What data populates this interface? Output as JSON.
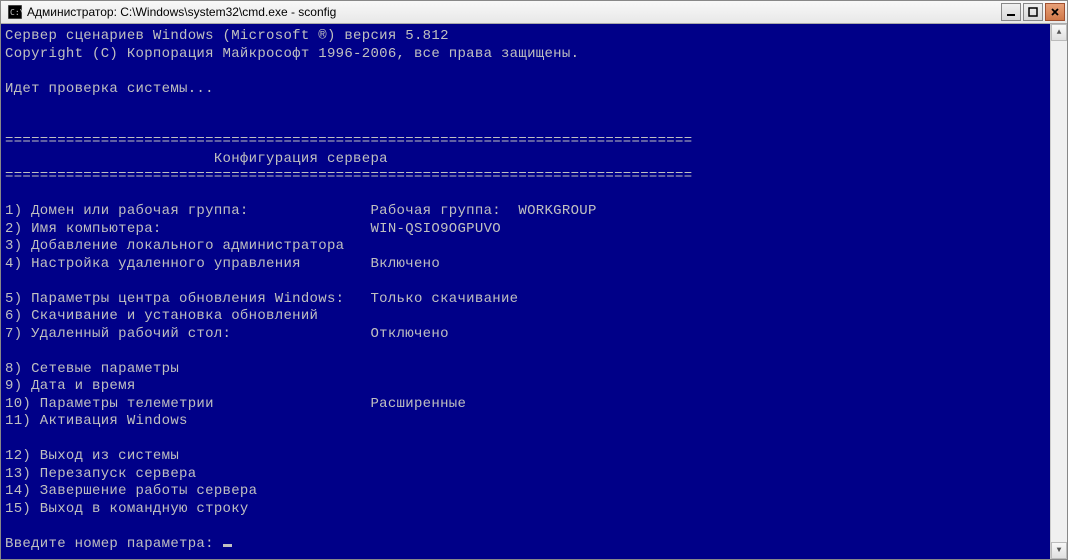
{
  "window": {
    "title": "Администратор: C:\\Windows\\system32\\cmd.exe - sconfig"
  },
  "console": {
    "header1": "Сервер сценариев Windows (Microsoft ®) версия 5.812",
    "header2": "Copyright (C) Корпорация Майкрософт 1996-2006, все права защищены.",
    "checking": "Идет проверка системы...",
    "divider": "===============================================================================",
    "section_title": "                        Конфигурация сервера",
    "options": [
      {
        "num": "1",
        "label": "Домен или рабочая группа:",
        "value": "Рабочая группа:  WORKGROUP"
      },
      {
        "num": "2",
        "label": "Имя компьютера:",
        "value": "WIN-QSIO9OGPUVO"
      },
      {
        "num": "3",
        "label": "Добавление локального администратора",
        "value": ""
      },
      {
        "num": "4",
        "label": "Настройка удаленного управления",
        "value": "Включено"
      },
      {
        "num": "5",
        "label": "Параметры центра обновления Windows:",
        "value": "Только скачивание"
      },
      {
        "num": "6",
        "label": "Скачивание и установка обновлений",
        "value": ""
      },
      {
        "num": "7",
        "label": "Удаленный рабочий стол:",
        "value": "Отключено"
      },
      {
        "num": "8",
        "label": "Сетевые параметры",
        "value": ""
      },
      {
        "num": "9",
        "label": "Дата и время",
        "value": ""
      },
      {
        "num": "10",
        "label": "Параметры телеметрии",
        "value": "Расширенные"
      },
      {
        "num": "11",
        "label": "Активация Windows",
        "value": ""
      },
      {
        "num": "12",
        "label": "Выход из системы",
        "value": ""
      },
      {
        "num": "13",
        "label": "Перезапуск сервера",
        "value": ""
      },
      {
        "num": "14",
        "label": "Завершение работы сервера",
        "value": ""
      },
      {
        "num": "15",
        "label": "Выход в командную строку",
        "value": ""
      }
    ],
    "prompt": "Введите номер параметра: "
  }
}
